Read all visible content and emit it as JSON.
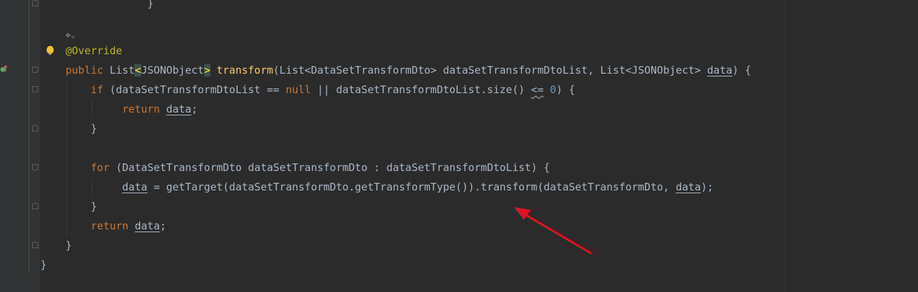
{
  "editor": {
    "annotation": "@Override",
    "code": {
      "line1_brace": "}",
      "method_kw": "public",
      "return_type": "List",
      "lt": "<",
      "type_json": "JSONObject",
      "gt": ">",
      "method_name": "transform",
      "params_open": "(List<DataSetTransformDto> dataSetTransformDtoList, List<JSONObject> ",
      "param_data": "data",
      "params_close": ") {",
      "if_kw": "if",
      "if_cond1": " (dataSetTransformDtoList == ",
      "null_kw": "null",
      "if_cond2": " || dataSetTransformDtoList.size() ",
      "le_op": "<=",
      "space": " ",
      "zero": "0",
      "if_close": ") {",
      "return_kw": "return",
      "return_data": "data",
      "semicolon": ";",
      "close_brace": "}",
      "for_kw": "for",
      "for_body": " (DataSetTransformDto dataSetTransformDto : dataSetTransformDtoList) {",
      "assign_data": "data",
      "assign_expr": " = getTarget(dataSetTransformDto.getTransformType()).transform(dataSetTransformDto, ",
      "assign_arg": "data",
      "assign_end": ");",
      "final_return_kw": "return",
      "final_return_data": "data",
      "method_close": "}",
      "class_close": "}"
    },
    "colors": {
      "background": "#2b2b2b",
      "keyword": "#cc7832",
      "annotation": "#bbb529",
      "method": "#ffc66d",
      "number": "#6897bb",
      "text": "#a9b7c6",
      "arrow": "#e0141e"
    },
    "icons": {
      "hint": "inlay-hint-icon",
      "bulb": "lightbulb-icon",
      "override": "override-method-icon",
      "arrow": "red-annotation-arrow"
    }
  }
}
